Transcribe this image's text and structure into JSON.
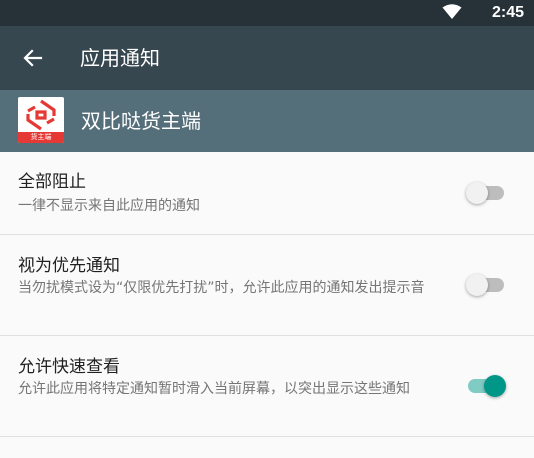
{
  "status_bar": {
    "time": "2:45",
    "wifi_icon": "wifi-icon"
  },
  "app_bar": {
    "title": "应用通知",
    "back_icon": "arrow-back-icon"
  },
  "app_info": {
    "name": "双比哒货主端",
    "icon_label": "货主端",
    "icon_color": "#e53935"
  },
  "preferences": [
    {
      "title": "全部阻止",
      "summary": "一律不显示来自此应用的通知",
      "enabled": false
    },
    {
      "title": "视为优先通知",
      "summary": "当勿扰模式设为“仅限优先打扰”时，允许此应用的通知发出提示音",
      "enabled": false
    },
    {
      "title": "允许快速查看",
      "summary": "允许此应用将特定通知暂时滑入当前屏幕，以突出显示这些通知",
      "enabled": true
    }
  ],
  "colors": {
    "accent": "#009688",
    "app_bar": "#37474f",
    "status_bar": "#263238",
    "app_info_bar": "#546e7a"
  }
}
